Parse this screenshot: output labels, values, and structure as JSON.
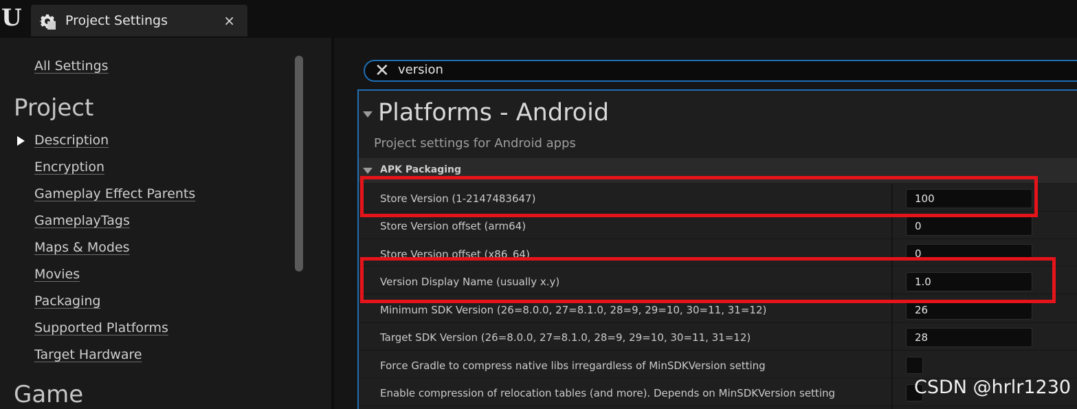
{
  "window": {
    "tab_title": "Project Settings",
    "close_glyph": "×",
    "logo": "U",
    "logo_icon": "unreal-engine-logo-icon",
    "tab_icon": "settings-cog-icon"
  },
  "sidebar": {
    "all_settings": "All Settings",
    "heading_project": "Project",
    "items": [
      {
        "label": "Description",
        "expanded_arrow": true
      },
      {
        "label": "Encryption"
      },
      {
        "label": "Gameplay Effect Parents"
      },
      {
        "label": "GameplayTags"
      },
      {
        "label": "Maps & Modes"
      },
      {
        "label": "Movies"
      },
      {
        "label": "Packaging"
      },
      {
        "label": "Supported Platforms"
      },
      {
        "label": "Target Hardware"
      }
    ],
    "heading_game": "Game"
  },
  "search": {
    "value": "version",
    "clear_icon": "clear-x-icon"
  },
  "section": {
    "title": "Platforms - Android",
    "description": "Project settings for Android apps",
    "category": "APK Packaging"
  },
  "settings": [
    {
      "label": "Store Version (1-2147483647)",
      "value": "100",
      "highlighted": true
    },
    {
      "label": "Store Version offset (arm64)",
      "value": "0"
    },
    {
      "label": "Store Version offset (x86_64)",
      "value": "0"
    },
    {
      "label": "Version Display Name (usually x.y)",
      "value": "1.0",
      "highlighted": true
    },
    {
      "label": "Minimum SDK Version (26=8.0.0, 27=8.1.0, 28=9, 29=10, 30=11, 31=12)",
      "value": "26"
    },
    {
      "label": "Target SDK Version (26=8.0.0, 27=8.1.0, 28=9, 29=10, 30=11, 31=12)",
      "value": "28"
    },
    {
      "label": "Force Gradle to compress native libs irregardless of MinSDKVersion setting",
      "checked": false
    },
    {
      "label": "Enable compression of relocation tables (and more). Depends on MinSDKVersion setting",
      "checked": false
    }
  ],
  "colors": {
    "highlight": "#e5141b",
    "accent": "#1f6fb5"
  },
  "watermark": "CSDN @hrlr1230"
}
